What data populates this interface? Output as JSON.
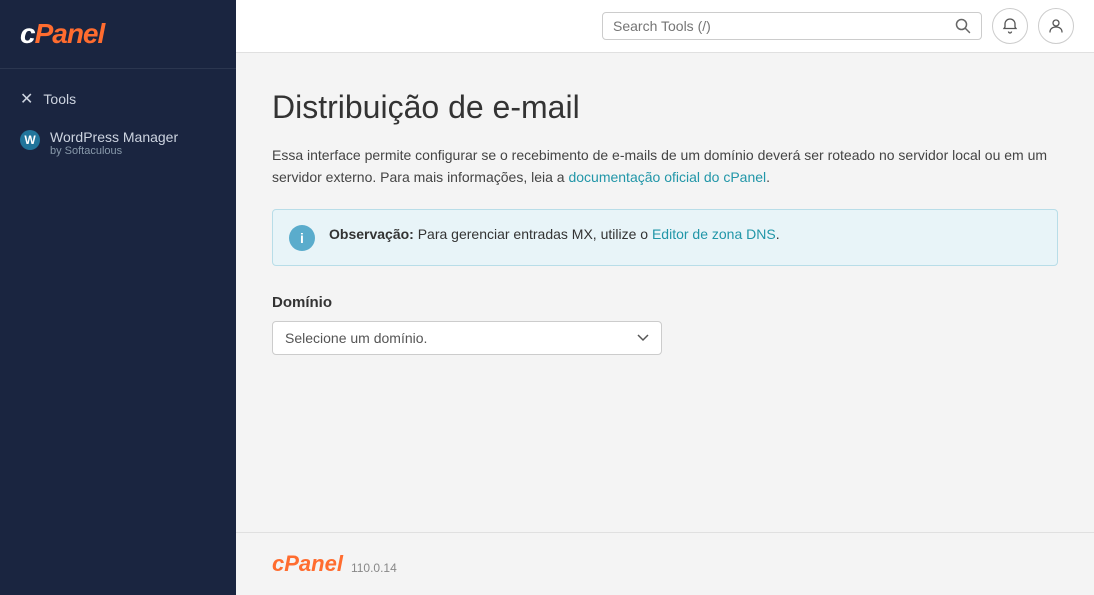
{
  "sidebar": {
    "logo": "cPanel",
    "items": [
      {
        "id": "tools",
        "label": "Tools",
        "icon": "✕"
      },
      {
        "id": "wordpress-manager",
        "label": "WordPress Manager",
        "sub": "by Softaculous",
        "icon": "W"
      }
    ]
  },
  "header": {
    "search_placeholder": "Search Tools (/)",
    "search_shortcut": "(/)",
    "notification_label": "Notifications",
    "user_label": "User"
  },
  "main": {
    "title": "Distribuição de e-mail",
    "description_part1": "Essa interface permite configurar se o recebimento de e-mails de um domínio deverá ser roteado no servidor local ou em um servidor externo. Para mais informações, leia a ",
    "description_link_text": "documentação oficial do cPanel",
    "description_part2": ".",
    "info_bold": "Observação:",
    "info_text": " Para gerenciar entradas MX, utilize o ",
    "info_link_text": "Editor de zona DNS",
    "info_end": ".",
    "domain_label": "Domínio",
    "domain_placeholder": "Selecione um domínio.",
    "domain_options": [
      {
        "value": "",
        "label": "Selecione um domínio."
      }
    ]
  },
  "footer": {
    "logo": "cPanel",
    "version": "110.0.14"
  }
}
